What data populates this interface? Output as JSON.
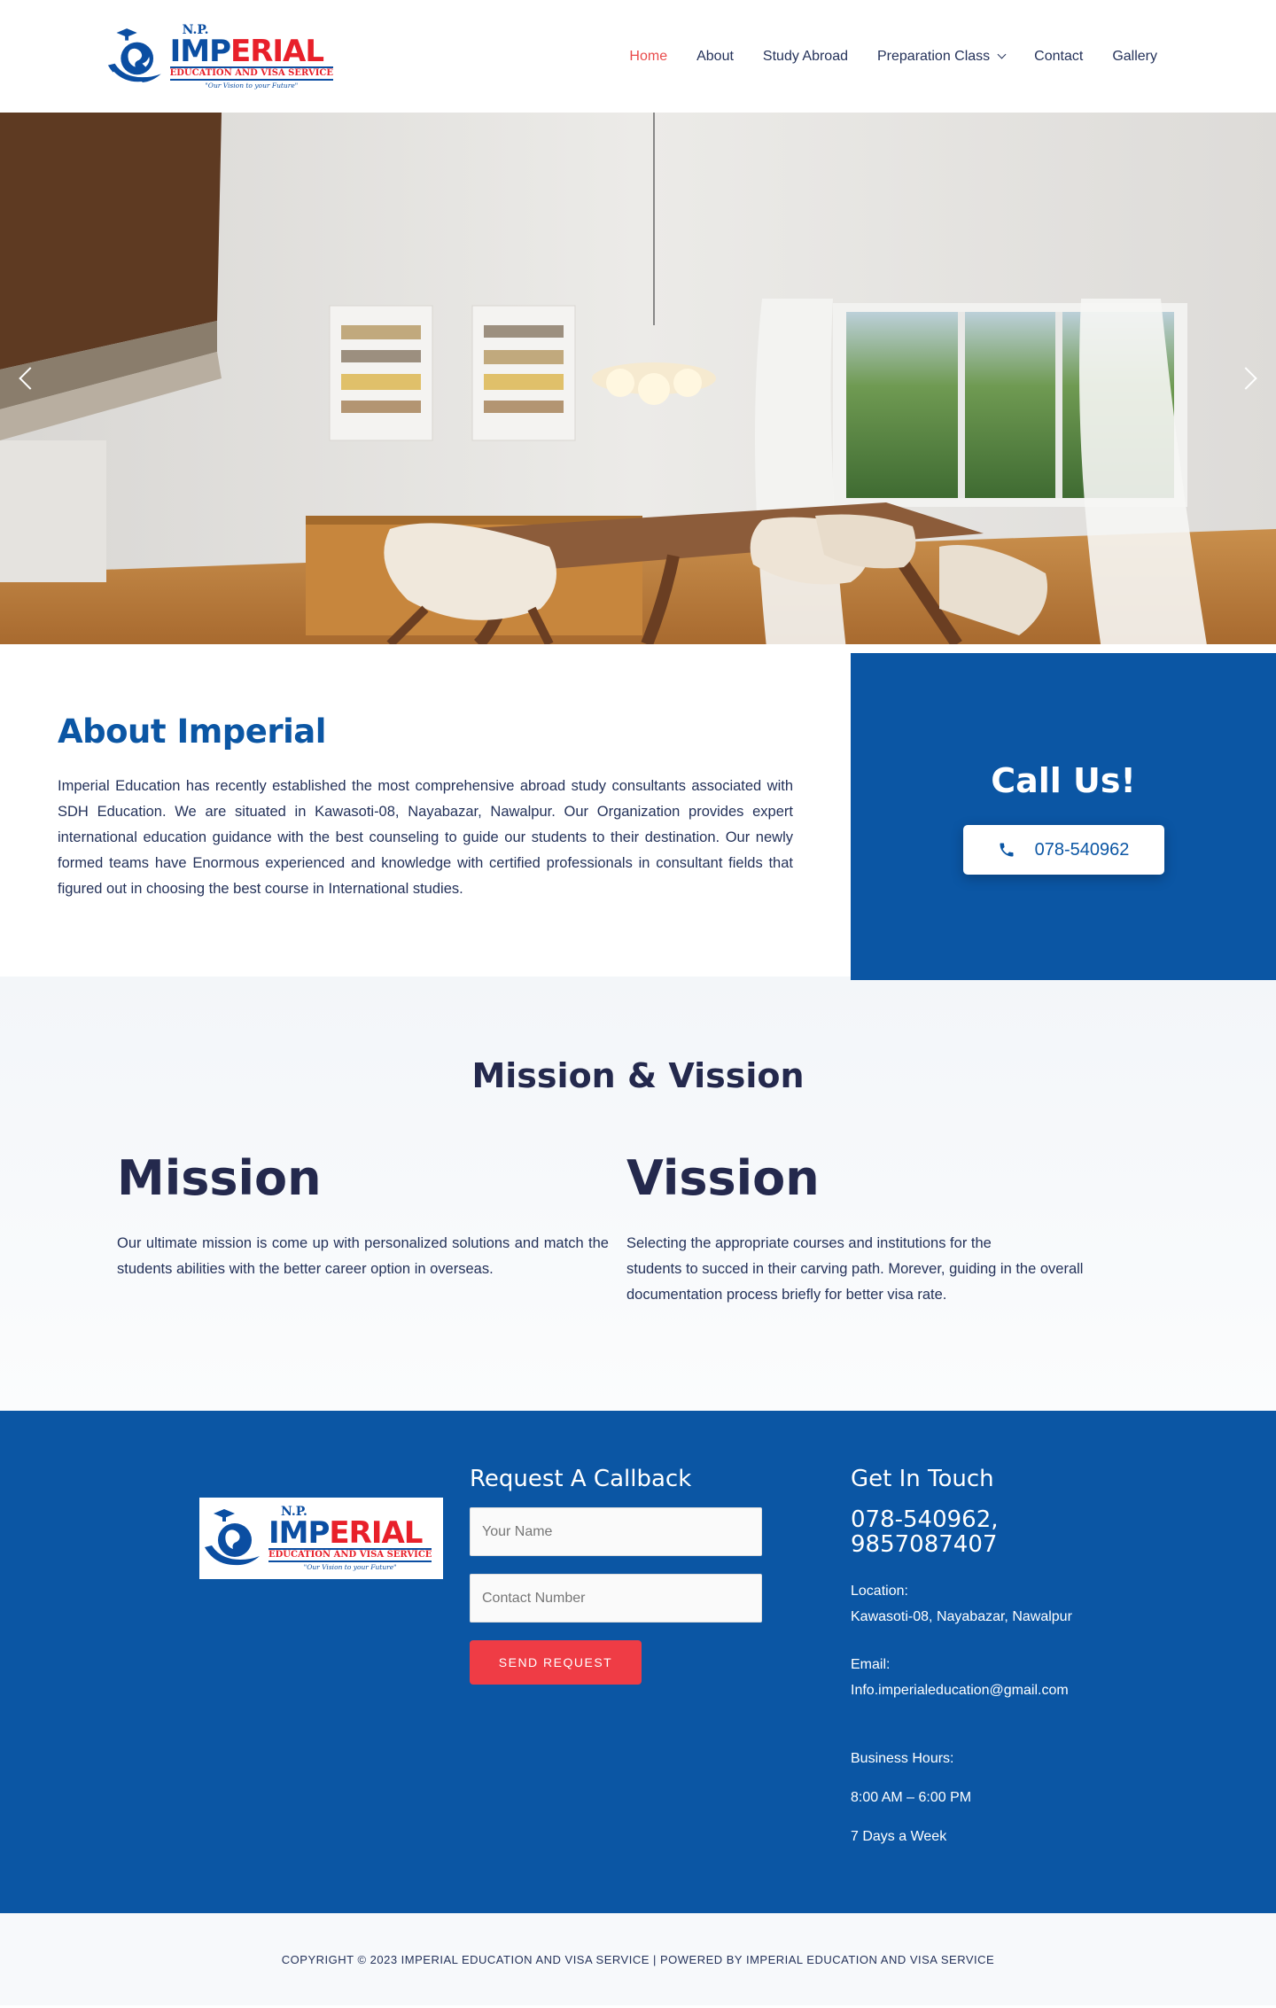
{
  "brand": {
    "np": "N.P.",
    "name_blue": "IMP",
    "name_red": "ERIAL",
    "subtitle": "EDUCATION AND VISA SERVICE",
    "tagline": "\"Our Vision to your Future\""
  },
  "nav": {
    "items": [
      {
        "label": "Home",
        "active": true
      },
      {
        "label": "About"
      },
      {
        "label": "Study Abroad"
      },
      {
        "label": "Preparation Class",
        "dropdown": true
      },
      {
        "label": "Contact"
      },
      {
        "label": "Gallery"
      }
    ]
  },
  "hero": {
    "prev_icon": "chevron-left-icon",
    "next_icon": "chevron-right-icon"
  },
  "about": {
    "title": "About Imperial",
    "body": "Imperial Education has recently established the most comprehensive abroad study consultants associated with SDH Education. We are situated in Kawasoti-08, Nayabazar, Nawalpur. Our Organization provides expert international education guidance with the best counseling to guide our students to their destination. Our newly formed teams have Enormous experienced and knowledge with certified professionals in consultant fields that figured out in choosing the best course in International studies."
  },
  "callus": {
    "title": "Call Us!",
    "phone": "078-540962",
    "icon": "phone-icon"
  },
  "mission": {
    "section_title": "Mission & Vission",
    "mission_title": "Mission",
    "mission_body": "Our ultimate mission is come up with personalized solutions and match the students abilities with the better career option in overseas.",
    "vision_title": "Vission",
    "vision_body_1": "Selecting the appropriate courses and institutions for the",
    "vision_body_2": "students to succed in their carving path. Morever, guiding in the overall documentation process briefly for better visa rate."
  },
  "footer": {
    "callback_title": "Request A Callback",
    "name_placeholder": "Your Name",
    "contact_placeholder": "Contact Number",
    "send_label": "SEND REQUEST",
    "touch_title": "Get In Touch",
    "phones": "078-540962, 9857087407",
    "location_label": "Location:",
    "location": "Kawasoti-08, Nayabazar, Nawalpur",
    "email_label": "Email:",
    "email": "Info.imperialeducation@gmail.com",
    "hours_label": "Business Hours:",
    "hours": "8:00 AM – 6:00 PM",
    "days": "7 Days a Week"
  },
  "copyright": "COPYRIGHT © 2023 IMPERIAL EDUCATION AND VISA SERVICE | POWERED BY IMPERIAL EDUCATION AND VISA SERVICE",
  "colors": {
    "brand_blue": "#0b56a4",
    "accent_red": "#ef3c45",
    "nav_active": "#e94b4b",
    "dark_text": "#24294d"
  }
}
